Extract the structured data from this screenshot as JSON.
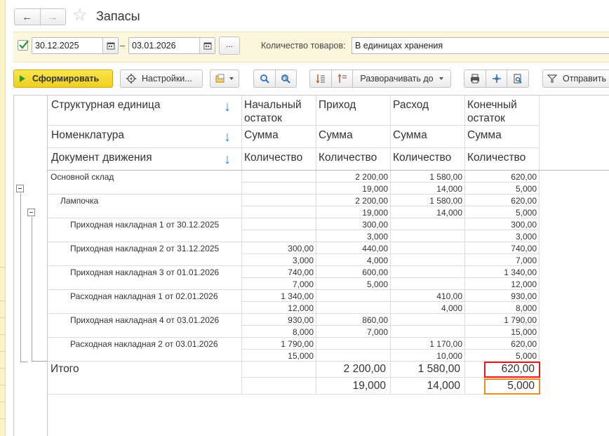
{
  "window": {
    "title": "Запасы",
    "back_label": "←",
    "forward_label": "→",
    "star_label": "☆"
  },
  "filters": {
    "period_enabled": true,
    "date_from": "30.12.2025",
    "date_separator": "–",
    "date_to": "03.01.2026",
    "period_button_label": "...",
    "quantity_label": "Количество товаров:",
    "quantity_value": "В единицах хранения"
  },
  "toolbar": {
    "generate_label": "Сформировать",
    "settings_label": "Настройки...",
    "expand_label": "Разворачивать до",
    "send_label": "Отправить"
  },
  "report": {
    "header": {
      "row_dims": [
        "Структурная единица",
        "Номенклатура",
        "Документ движения"
      ],
      "col_groups": [
        {
          "title_1": "Начальный",
          "title_2": "остаток",
          "sum": "Сумма",
          "qty": "Количество"
        },
        {
          "title_1": "Приход",
          "title_2": "",
          "sum": "Сумма",
          "qty": "Количество"
        },
        {
          "title_1": "Расход",
          "title_2": "",
          "sum": "Сумма",
          "qty": "Количество"
        },
        {
          "title_1": "Конечный",
          "title_2": "остаток",
          "sum": "Сумма",
          "qty": "Количество"
        }
      ]
    },
    "rows": [
      {
        "label": "Основной склад",
        "level": 0,
        "sum": [
          "",
          "2 200,00",
          "1 580,00",
          "620,00"
        ],
        "qty": [
          "",
          "19,000",
          "14,000",
          "5,000"
        ]
      },
      {
        "label": "Лампочка",
        "level": 1,
        "sum": [
          "",
          "2 200,00",
          "1 580,00",
          "620,00"
        ],
        "qty": [
          "",
          "19,000",
          "14,000",
          "5,000"
        ]
      },
      {
        "label": "Приходная накладная 1 от 30.12.2025",
        "level": 2,
        "sum": [
          "",
          "300,00",
          "",
          "300,00"
        ],
        "qty": [
          "",
          "3,000",
          "",
          "3,000"
        ]
      },
      {
        "label": "Приходная накладная 2 от 31.12.2025",
        "level": 2,
        "sum": [
          "300,00",
          "440,00",
          "",
          "740,00"
        ],
        "qty": [
          "3,000",
          "4,000",
          "",
          "7,000"
        ]
      },
      {
        "label": "Приходная накладная 3 от 01.01.2026",
        "level": 2,
        "sum": [
          "740,00",
          "600,00",
          "",
          "1 340,00"
        ],
        "qty": [
          "7,000",
          "5,000",
          "",
          "12,000"
        ]
      },
      {
        "label": "Расходная накладная 1 от 02.01.2026",
        "level": 2,
        "sum": [
          "1 340,00",
          "",
          "410,00",
          "930,00"
        ],
        "qty": [
          "12,000",
          "",
          "4,000",
          "8,000"
        ]
      },
      {
        "label": "Приходная накладная 4 от 03.01.2026",
        "level": 2,
        "sum": [
          "930,00",
          "860,00",
          "",
          "1 790,00"
        ],
        "qty": [
          "8,000",
          "7,000",
          "",
          "15,000"
        ]
      },
      {
        "label": "Расходная накладная 2 от 03.01.2026",
        "level": 2,
        "sum": [
          "1 790,00",
          "",
          "1 170,00",
          "620,00"
        ],
        "qty": [
          "15,000",
          "",
          "10,000",
          "5,000"
        ]
      }
    ],
    "total": {
      "label": "Итого",
      "sum": [
        "",
        "2 200,00",
        "1 580,00",
        "620,00"
      ],
      "qty": [
        "",
        "19,000",
        "14,000",
        "5,000"
      ]
    },
    "highlight_colors": {
      "end_sum": "#e5191c",
      "end_qty": "#f08a24"
    }
  }
}
